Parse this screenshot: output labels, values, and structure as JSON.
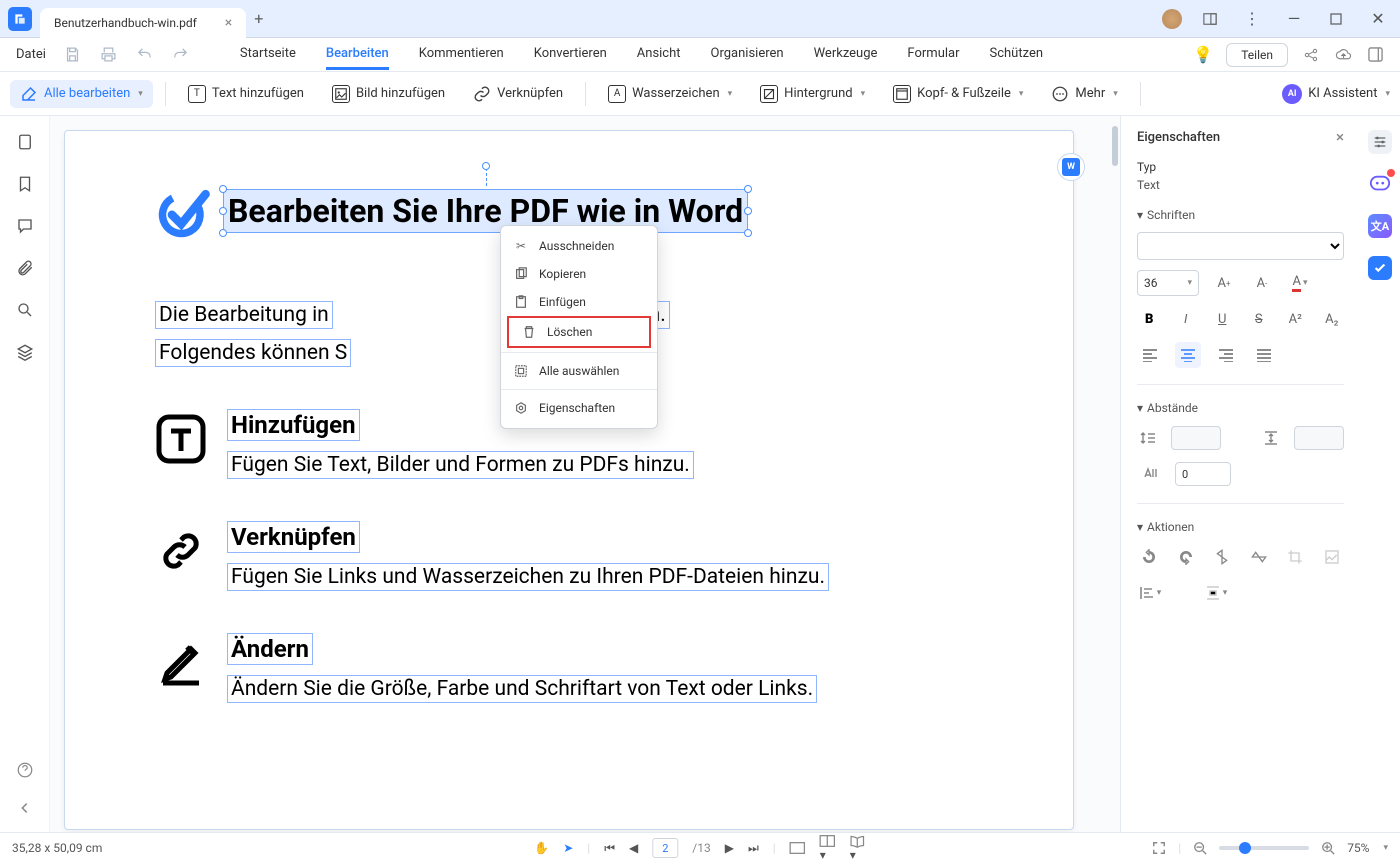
{
  "titlebar": {
    "tab_title": "Benutzerhandbuch-win.pdf"
  },
  "menubar": {
    "file": "Datei",
    "tabs": [
      "Startseite",
      "Bearbeiten",
      "Kommentieren",
      "Konvertieren",
      "Ansicht",
      "Organisieren",
      "Werkzeuge",
      "Formular",
      "Schützen"
    ],
    "active_tab": 1,
    "share": "Teilen"
  },
  "toolbar": {
    "edit_all": "Alle bearbeiten",
    "add_text": "Text hinzufügen",
    "add_image": "Bild hinzufügen",
    "link": "Verknüpfen",
    "watermark": "Wasserzeichen",
    "background": "Hintergrund",
    "header_footer": "Kopf- & Fußzeile",
    "more": "Mehr",
    "ai": "KI Assistent"
  },
  "page_content": {
    "title": "Bearbeiten Sie Ihre PDF wie in Word",
    "line1_a": "Die Bearbeitung in",
    "line1_b": "ist sehr einfach.",
    "line2": "Folgendes können S",
    "feat1_title": "Hinzufügen",
    "feat1_desc": "Fügen Sie Text, Bilder und Formen zu PDFs hinzu.",
    "feat2_title": "Verknüpfen",
    "feat2_desc": "Fügen Sie Links und Wasserzeichen zu Ihren PDF-Dateien hinzu.",
    "feat3_title": "Ändern",
    "feat3_desc": "Ändern Sie die Größe, Farbe und Schriftart von Text oder Links."
  },
  "context_menu": {
    "cut": "Ausschneiden",
    "copy": "Kopieren",
    "paste": "Einfügen",
    "delete": "Löschen",
    "select_all": "Alle auswählen",
    "properties": "Eigenschaften"
  },
  "properties": {
    "title": "Eigenschaften",
    "type_label": "Typ",
    "type_value": "Text",
    "fonts": "Schriften",
    "font_size": "36",
    "spacing": "Abstände",
    "char_space": "0",
    "actions": "Aktionen"
  },
  "statusbar": {
    "coords": "35,28 x 50,09 cm",
    "page": "2",
    "page_total": "/13",
    "zoom": "75%"
  }
}
